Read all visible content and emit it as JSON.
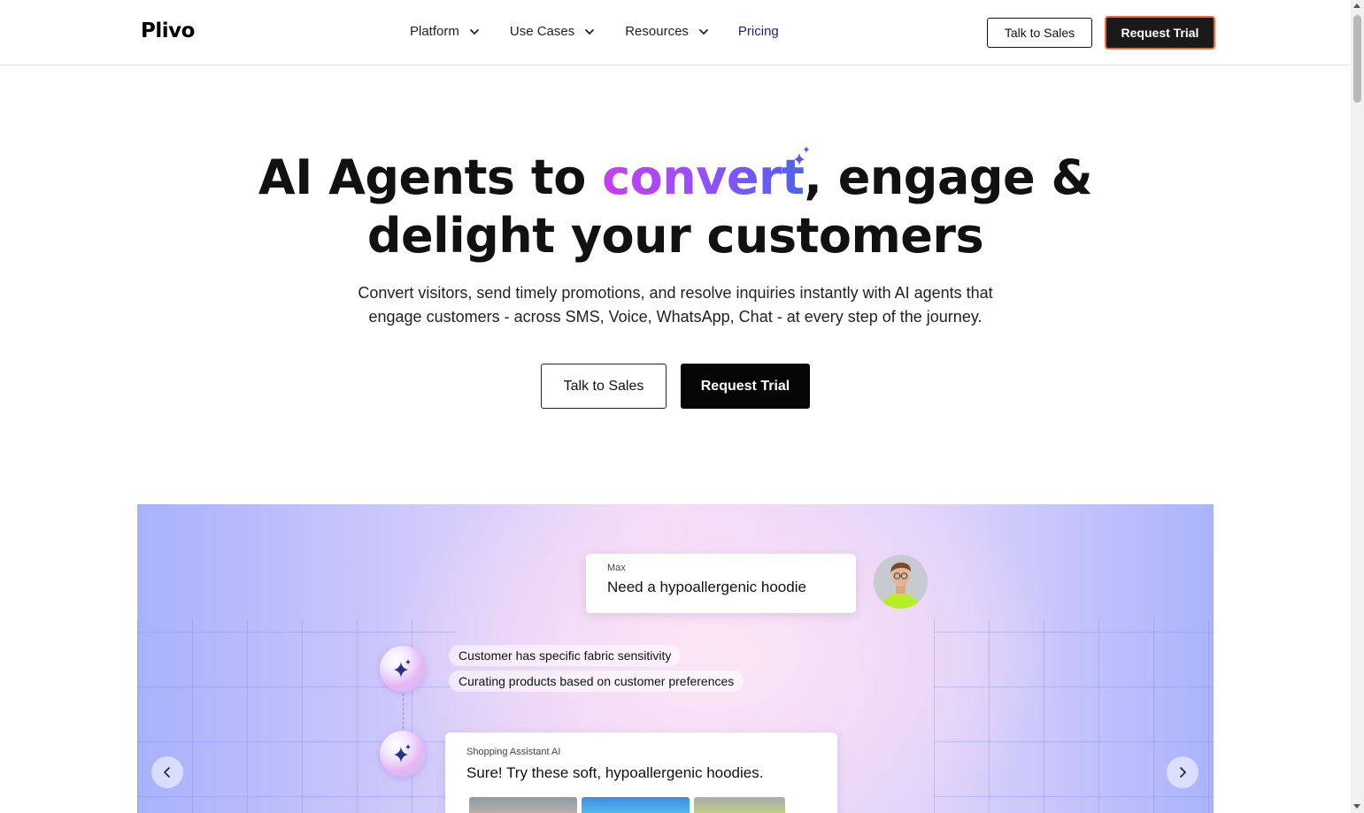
{
  "header": {
    "logo": "Plivo",
    "nav": [
      {
        "label": "Platform",
        "has_dropdown": true
      },
      {
        "label": "Use Cases",
        "has_dropdown": true
      },
      {
        "label": "Resources",
        "has_dropdown": true
      },
      {
        "label": "Pricing",
        "has_dropdown": false
      }
    ],
    "talk_to_sales": "Talk to Sales",
    "request_trial": "Request Trial"
  },
  "hero": {
    "title_part1": "AI Agents to ",
    "title_accent": "convert",
    "title_part2": ", engage &",
    "title_line2": "delight your customers",
    "subtitle_line1": "Convert visitors, send timely promotions, and resolve inquiries instantly with AI agents that",
    "subtitle_line2": "engage customers - across SMS, Voice, WhatsApp, Chat - at every step of the journey.",
    "cta_secondary": "Talk to Sales",
    "cta_primary": "Request Trial"
  },
  "showcase": {
    "user_message": {
      "name": "Max",
      "text": "Need a hypoallergenic hoodie"
    },
    "ai_steps": [
      "Customer has specific fabric sensitivity",
      "Curating products based on customer preferences"
    ],
    "ai_message": {
      "name": "Shopping Assistant AI",
      "text": "Sure! Try these soft, hypoallergenic hoodies."
    }
  },
  "colors": {
    "accent_gradient_start": "#c63ff0",
    "accent_gradient_end": "#4a63f0",
    "request_trial_border": "#f06a3a",
    "pricing_link": "#1a2b6d"
  },
  "icons": [
    "chevron-down-icon",
    "sparkle-icon",
    "ai-star-icon",
    "arrow-left-icon",
    "arrow-right-icon"
  ]
}
